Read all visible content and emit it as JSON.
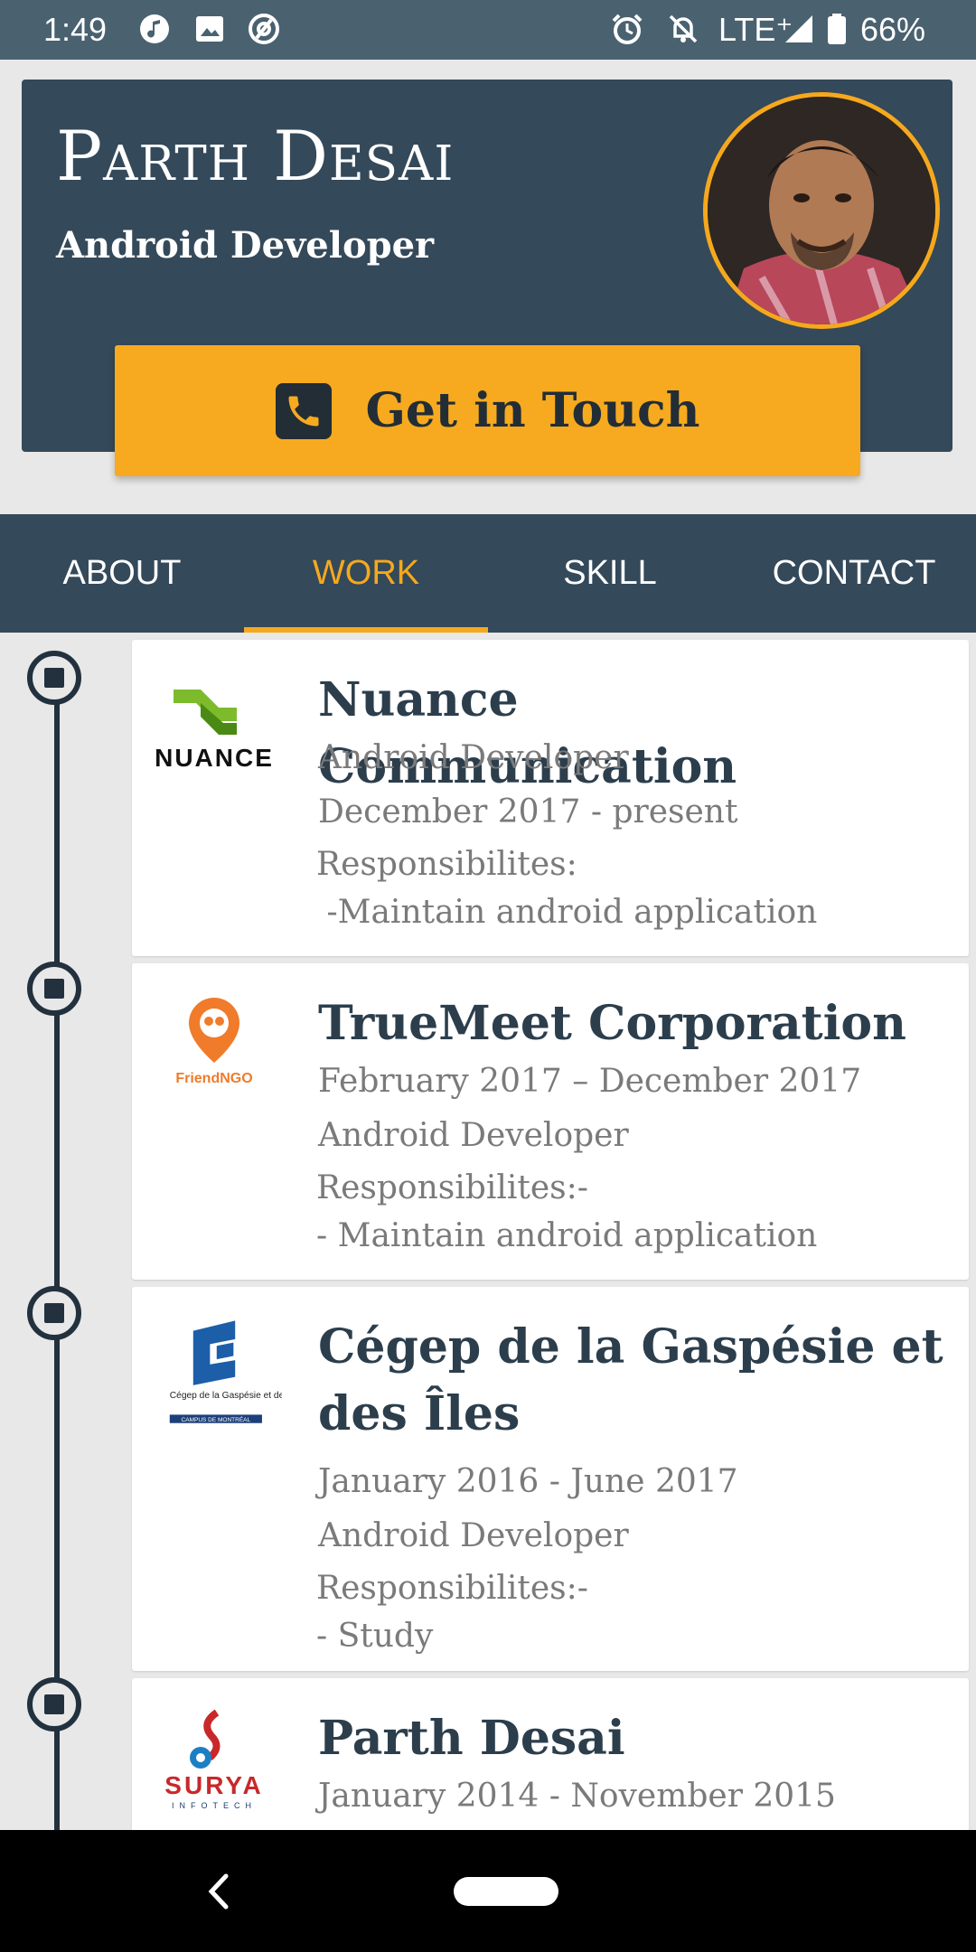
{
  "status_bar": {
    "time": "1:49",
    "network": "LTE⁺",
    "battery": "66%",
    "icons_left": [
      "music-icon",
      "image-icon",
      "at-icon"
    ],
    "icons_right": [
      "alarm-icon",
      "bell-off-icon",
      "signal-icon",
      "battery-icon"
    ]
  },
  "profile": {
    "name": "Parth Desai",
    "role": "Android Developer",
    "cta_label": "Get in Touch",
    "colors": {
      "header_bg": "#34495a",
      "accent": "#f6a81d"
    }
  },
  "tabs": [
    {
      "label": "ABOUT",
      "active": false
    },
    {
      "label": "WORK",
      "active": true
    },
    {
      "label": "SKILL",
      "active": false
    },
    {
      "label": "CONTACT",
      "active": false
    }
  ],
  "jobs": [
    {
      "company": "Nuance Communication",
      "logo_text": "NUANCE",
      "lines": [
        "Android Developer",
        "December 2017 - present",
        "Responsibilites:",
        " -Maintain android application"
      ]
    },
    {
      "company": "TrueMeet Corporation",
      "logo_text": "FriendNGO",
      "lines": [
        "February 2017 – December 2017",
        "Android Developer",
        "Responsibilites:-",
        "- Maintain android application"
      ]
    },
    {
      "company": "Cégep de la Gaspésie et des Îles",
      "logo_text": "Cégep de la Gaspésie et des Îles",
      "logo_subtext": "CAMPUS DE MONTRÉAL",
      "lines": [
        "January 2016 - June 2017",
        "Android Developer",
        "Responsibilites:-",
        "- Study"
      ]
    },
    {
      "company": "Parth Desai",
      "logo_text": "SURYA",
      "logo_subtext": "INFOTECH",
      "lines": [
        "January 2014 - November 2015"
      ]
    }
  ]
}
